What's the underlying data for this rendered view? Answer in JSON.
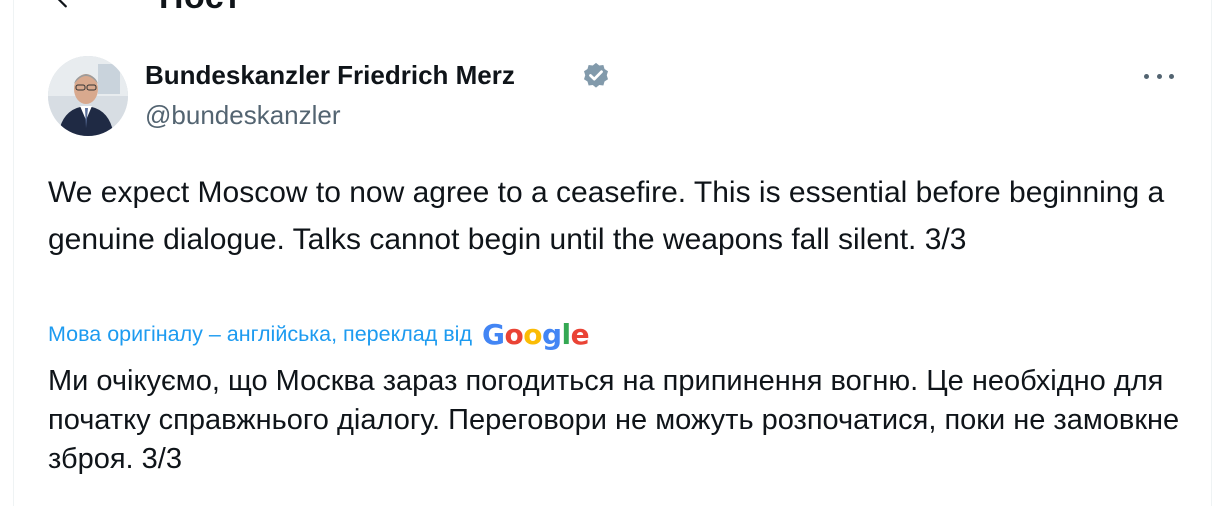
{
  "header": {
    "title": "Пост",
    "back_icon": "arrow-left-icon"
  },
  "tweet": {
    "author_name": "Bundeskanzler Friedrich Merz",
    "verified_icon": "verified-badge-icon",
    "verified_color": "#829aab",
    "handle": "@bundeskanzler",
    "more_icon": "more-horizontal-icon",
    "text": "We expect Moscow to now agree to a ceasefire. This is essential before beginning a genuine dialogue. Talks cannot begin until the weapons fall silent. 3/3",
    "translation_label": "Мова оригіналу – англійська, переклад від",
    "translation_provider_letters": [
      "G",
      "o",
      "o",
      "g",
      "l",
      "e"
    ],
    "translation_provider_colors": [
      "#4285f4",
      "#ea4335",
      "#fbbc05",
      "#4285f4",
      "#34a853",
      "#ea4335"
    ],
    "translated_text": "Ми очікуємо, що Москва зараз погодиться на припинення вогню. Це необхідно для початку справжнього діалогу. Переговори не можуть розпочатися, поки не замовкне зброя. 3/3"
  },
  "colors": {
    "accent": "#1d9bf0",
    "secondary_text": "#536471",
    "primary_text": "#0f1419"
  }
}
